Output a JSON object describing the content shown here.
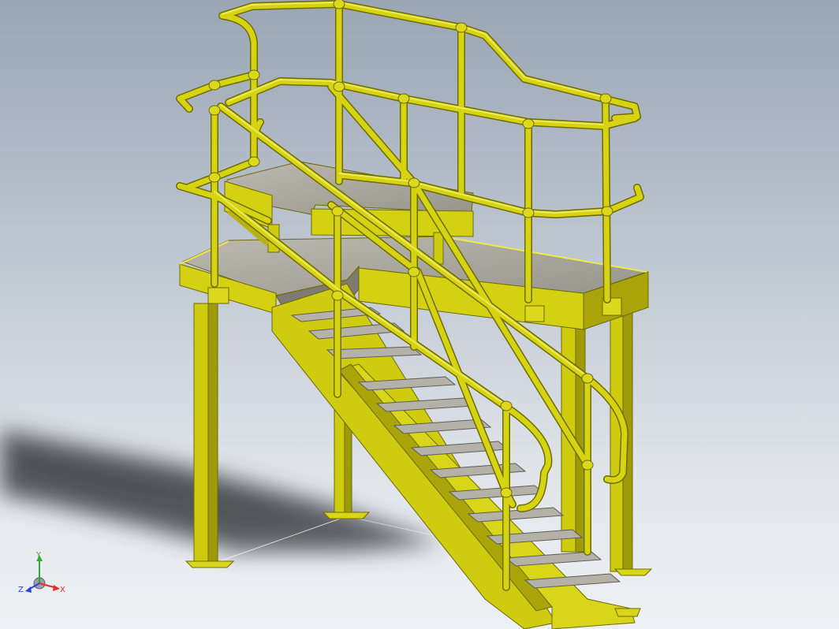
{
  "viewport": {
    "model": "steel-platform-with-stair",
    "background_top": "#9aa6b4",
    "background_bottom": "#eef1f4"
  },
  "colors": {
    "steel_yellow": "#d2cf12",
    "steel_yellow_dark": "#8f8b07",
    "steel_yellow_light": "#ecea4a",
    "grating_grey": "#a7a49c",
    "shadow": "#2a2d31",
    "axis_x": "#e0302a",
    "axis_y": "#2bb02b",
    "axis_z": "#2a45d8"
  },
  "triad": {
    "x_label": "X",
    "y_label": "Y",
    "z_label": "Z",
    "icon": "coordinate-triad-icon"
  }
}
